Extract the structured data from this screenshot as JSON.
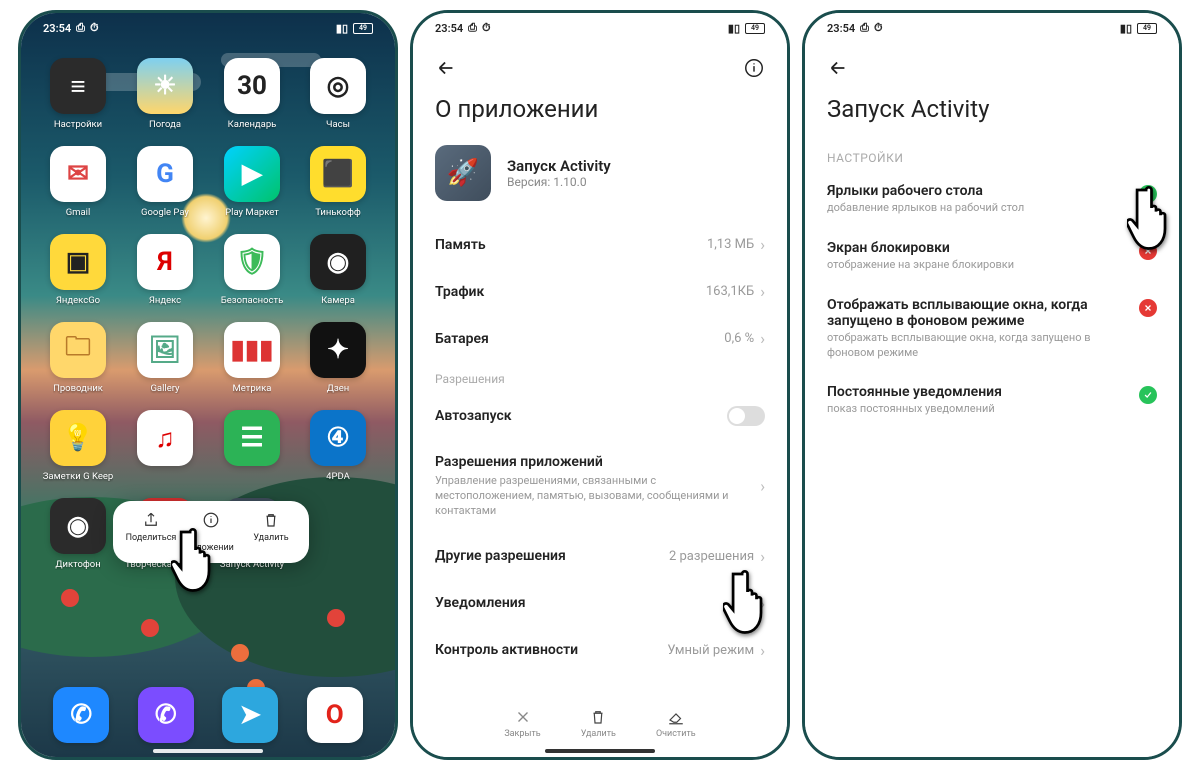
{
  "statusbar": {
    "time": "23:54",
    "battery": "49"
  },
  "home": {
    "apps": [
      {
        "label": "Настройки",
        "bg": "#2b2b2b",
        "glyph": "≡",
        "fg": "#fff"
      },
      {
        "label": "Погода",
        "bg": "linear-gradient(180deg,#7ed0f0,#ffd66b)",
        "glyph": "☀",
        "fg": "#fff"
      },
      {
        "label": "Календарь",
        "bg": "#fff",
        "glyph": "30",
        "fg": "#222"
      },
      {
        "label": "Часы",
        "bg": "#fff",
        "glyph": "◎",
        "fg": "#222"
      },
      {
        "label": "Gmail",
        "bg": "#fff",
        "glyph": "✉",
        "fg": "#d44"
      },
      {
        "label": "Google Pay",
        "bg": "#fff",
        "glyph": "G",
        "fg": "#4285F4"
      },
      {
        "label": "Play Маркет",
        "bg": "linear-gradient(135deg,#00d2ff,#00c36b)",
        "glyph": "▶",
        "fg": "#fff"
      },
      {
        "label": "Тинькофф",
        "bg": "#ffdd2d",
        "glyph": "⬛",
        "fg": "#222"
      },
      {
        "label": "ЯндексGo",
        "bg": "#ffd93b",
        "glyph": "▣",
        "fg": "#222"
      },
      {
        "label": "Яндекс",
        "bg": "#fff",
        "glyph": "Я",
        "fg": "#d00"
      },
      {
        "label": "Безопасность",
        "bg": "#fff",
        "glyph": "🛡",
        "fg": "#3dbb5a"
      },
      {
        "label": "Камера",
        "bg": "#202020",
        "glyph": "◉",
        "fg": "#fff"
      },
      {
        "label": "Проводник",
        "bg": "#ffd76b",
        "glyph": "🗀",
        "fg": "#b87a2a"
      },
      {
        "label": "Gallery",
        "bg": "#fff",
        "glyph": "🖼",
        "fg": "#5a8"
      },
      {
        "label": "Метрика",
        "bg": "#fff",
        "glyph": "▮▮▮",
        "fg": "#d33"
      },
      {
        "label": "Дзен",
        "bg": "#111",
        "glyph": "✦",
        "fg": "#fff"
      },
      {
        "label": "Заметки G Keep",
        "bg": "#ffd23a",
        "glyph": "💡",
        "fg": "#fff"
      },
      {
        "label": "",
        "bg": "#fff",
        "glyph": "♫",
        "fg": "#d00"
      },
      {
        "label": "",
        "bg": "#2cb356",
        "glyph": "☰",
        "fg": "#fff"
      },
      {
        "label": "4PDA",
        "bg": "#0b74c9",
        "glyph": "④",
        "fg": "#fff"
      },
      {
        "label": "Диктофон",
        "bg": "#2b2b2b",
        "glyph": "◉",
        "fg": "#fff"
      },
      {
        "label": "Творческая студия YouTube",
        "bg": "#d32f2f",
        "glyph": "✿",
        "fg": "#fff"
      },
      {
        "label": "Запуск Activity",
        "bg": "#3f4d5c",
        "glyph": "🚀",
        "fg": "#fff"
      }
    ],
    "dock": [
      {
        "label": "Phone",
        "bg": "#1e88ff",
        "glyph": "✆",
        "fg": "#fff"
      },
      {
        "label": "Viber",
        "bg": "#7b4dff",
        "glyph": "✆",
        "fg": "#fff"
      },
      {
        "label": "Telegram",
        "bg": "#2da7de",
        "glyph": "➤",
        "fg": "#fff"
      },
      {
        "label": "Opera",
        "bg": "#fff",
        "glyph": "O",
        "fg": "#e2231a"
      }
    ],
    "popover": {
      "share": "Поделиться",
      "about": "О приложении",
      "delete": "Удалить"
    }
  },
  "phone2": {
    "title": "О приложении",
    "appname": "Запуск Activity",
    "version": "Версия: 1.10.0",
    "rows": {
      "memory": {
        "k": "Память",
        "v": "1,13 МБ"
      },
      "traffic": {
        "k": "Трафик",
        "v": "163,1КБ"
      },
      "battery": {
        "k": "Батарея",
        "v": "0,6 %"
      }
    },
    "section": "Разрешения",
    "autostart": "Автозапуск",
    "appperm": {
      "k": "Разрешения приложений",
      "sub": "Управление разрешениями, связанными с местоположением, памятью, вызовами, сообщениями и контактами"
    },
    "otherperm": {
      "k": "Другие разрешения",
      "v": "2 разрешения"
    },
    "notif": "Уведомления",
    "activity": {
      "k": "Контроль активности",
      "v": "Умный режим"
    },
    "bottom": {
      "close": "Закрыть",
      "delete": "Удалить",
      "clear": "Очистить"
    }
  },
  "phone3": {
    "title": "Запуск Activity",
    "section": "НАСТРОЙКИ",
    "opts": [
      {
        "t": "Ярлыки рабочего стола",
        "s": "добавление ярлыков на рабочий стол",
        "b": "green"
      },
      {
        "t": "Экран блокировки",
        "s": "отображение на экране блокировки",
        "b": "red"
      },
      {
        "t": "Отображать всплывающие окна, когда запущено в фоновом режиме",
        "s": "отображать всплывающие окна, когда запущено в фоновом режиме",
        "b": "red"
      },
      {
        "t": "Постоянные уведомления",
        "s": "показ постоянных уведомлений",
        "b": "green"
      }
    ]
  }
}
